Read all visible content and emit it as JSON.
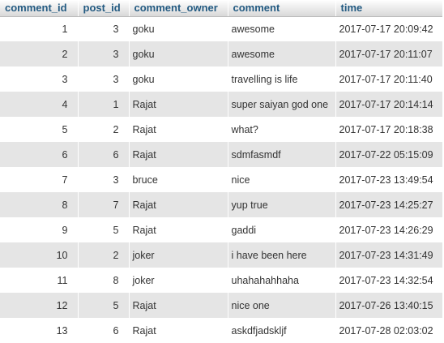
{
  "table": {
    "columns": [
      "comment_id",
      "post_id",
      "comment_owner",
      "comment",
      "time"
    ],
    "rows": [
      {
        "comment_id": "1",
        "post_id": "3",
        "comment_owner": "goku",
        "comment": "awesome",
        "time": "2017-07-17 20:09:42"
      },
      {
        "comment_id": "2",
        "post_id": "3",
        "comment_owner": "goku",
        "comment": "awesome",
        "time": "2017-07-17 20:11:07"
      },
      {
        "comment_id": "3",
        "post_id": "3",
        "comment_owner": "goku",
        "comment": "travelling is life",
        "time": "2017-07-17 20:11:40"
      },
      {
        "comment_id": "4",
        "post_id": "1",
        "comment_owner": "Rajat",
        "comment": "super saiyan god one",
        "time": "2017-07-17 20:14:14"
      },
      {
        "comment_id": "5",
        "post_id": "2",
        "comment_owner": "Rajat",
        "comment": "what?",
        "time": "2017-07-17 20:18:38"
      },
      {
        "comment_id": "6",
        "post_id": "6",
        "comment_owner": "Rajat",
        "comment": "sdmfasmdf",
        "time": "2017-07-22 05:15:09"
      },
      {
        "comment_id": "7",
        "post_id": "3",
        "comment_owner": "bruce",
        "comment": "nice",
        "time": "2017-07-23 13:49:54"
      },
      {
        "comment_id": "8",
        "post_id": "7",
        "comment_owner": "Rajat",
        "comment": "yup true",
        "time": "2017-07-23 14:25:27"
      },
      {
        "comment_id": "9",
        "post_id": "5",
        "comment_owner": "Rajat",
        "comment": "gaddi",
        "time": "2017-07-23 14:26:29"
      },
      {
        "comment_id": "10",
        "post_id": "2",
        "comment_owner": "joker",
        "comment": "i have been here",
        "time": "2017-07-23 14:31:49"
      },
      {
        "comment_id": "11",
        "post_id": "8",
        "comment_owner": "joker",
        "comment": "uhahahahhaha",
        "time": "2017-07-23 14:32:54"
      },
      {
        "comment_id": "12",
        "post_id": "5",
        "comment_owner": "Rajat",
        "comment": "nice one",
        "time": "2017-07-26 13:40:15"
      },
      {
        "comment_id": "13",
        "post_id": "6",
        "comment_owner": "Rajat",
        "comment": "askdfjadskljf",
        "time": "2017-07-28 02:03:02"
      }
    ]
  },
  "colors": {
    "header_text": "#235a81",
    "odd_row": "#ffffff",
    "even_row": "#e5e5e5",
    "text": "#333333"
  }
}
